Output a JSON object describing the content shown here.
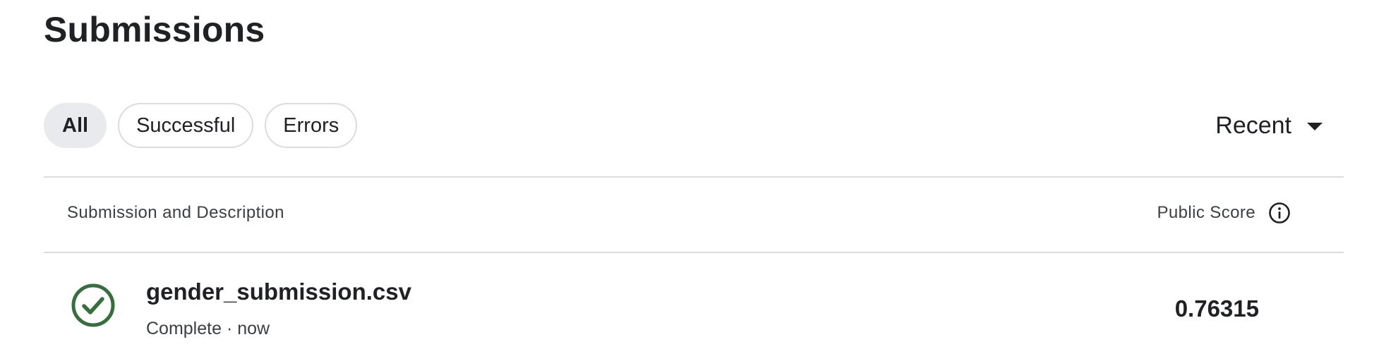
{
  "page": {
    "title": "Submissions"
  },
  "filters": {
    "all_label": "All",
    "successful_label": "Successful",
    "errors_label": "Errors",
    "active": "All"
  },
  "sort": {
    "label": "Recent",
    "icon": "caret-down-icon"
  },
  "table": {
    "columns": {
      "submission": "Submission and Description",
      "public_score": "Public Score",
      "public_score_icon": "info-icon"
    },
    "rows": [
      {
        "status_icon": "check-circle-icon",
        "status_color": "#34703c",
        "file_name": "gender_submission.csv",
        "meta": "Complete · now",
        "public_score": "0.76315"
      }
    ]
  },
  "colors": {
    "text_primary": "#202124",
    "text_secondary": "#3c4043",
    "border": "#dadce0",
    "chip_active_bg": "#e8eaed",
    "success": "#34703c"
  }
}
